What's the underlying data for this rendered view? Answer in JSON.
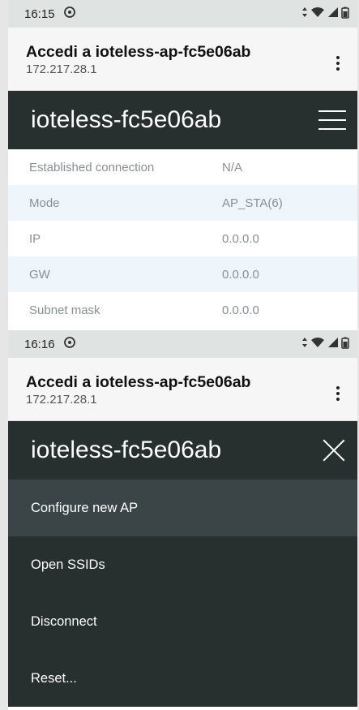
{
  "shot1": {
    "status": {
      "time": "16:15"
    },
    "url_bar": {
      "title": "Accedi a ioteless-ap-fc5e06ab",
      "host": "172.217.28.1"
    },
    "header": {
      "title": "ioteless-fc5e06ab"
    },
    "info_rows": [
      {
        "label": "Established connection",
        "value": "N/A"
      },
      {
        "label": "Mode",
        "value": "AP_STA(6)"
      },
      {
        "label": "IP",
        "value": "0.0.0.0"
      },
      {
        "label": "GW",
        "value": "0.0.0.0"
      },
      {
        "label": "Subnet mask",
        "value": "0.0.0.0"
      }
    ]
  },
  "shot2": {
    "status": {
      "time": "16:16"
    },
    "url_bar": {
      "title": "Accedi a ioteless-ap-fc5e06ab",
      "host": "172.217.28.1"
    },
    "header": {
      "title": "ioteless-fc5e06ab"
    },
    "menu": [
      {
        "label": "Configure new AP",
        "active": true
      },
      {
        "label": "Open SSIDs"
      },
      {
        "label": "Disconnect"
      },
      {
        "label": "Reset..."
      }
    ]
  }
}
